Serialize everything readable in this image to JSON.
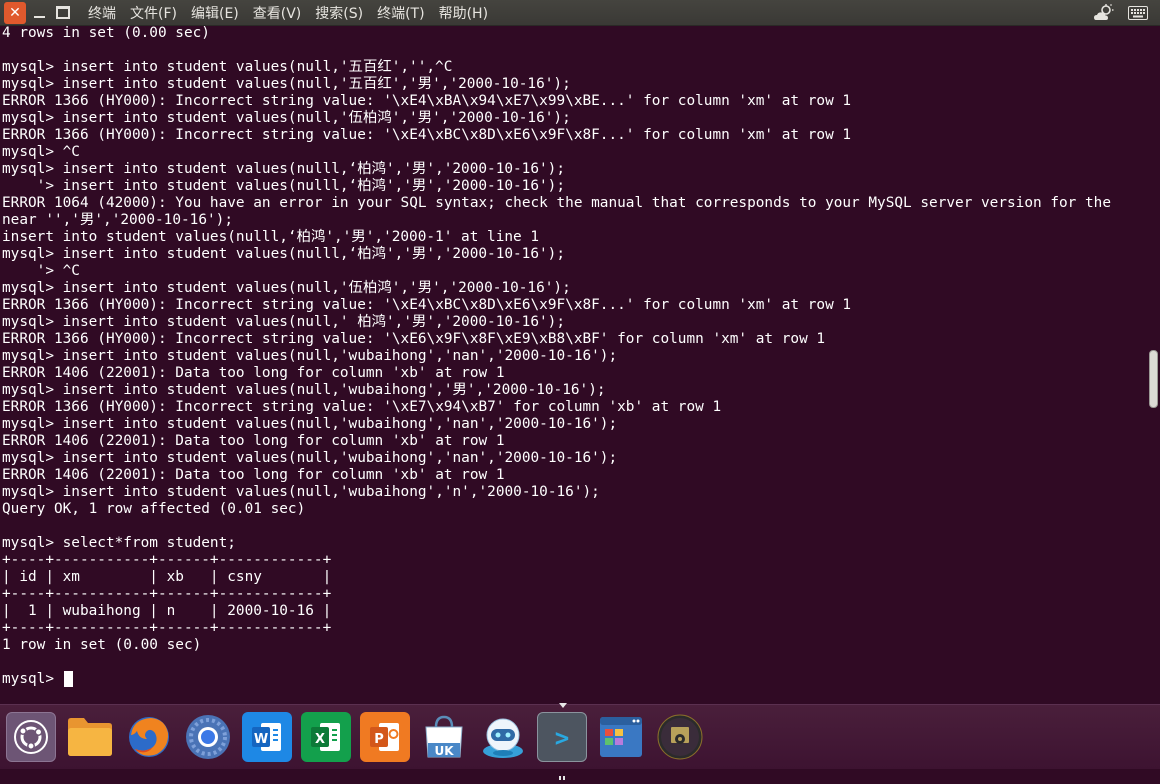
{
  "menubar": {
    "close_glyph": "✕",
    "items": [
      "终端",
      "文件(F)",
      "编辑(E)",
      "查看(V)",
      "搜索(S)",
      "终端(T)",
      "帮助(H)"
    ]
  },
  "terminal": {
    "lines": [
      "4 rows in set (0.00 sec)",
      "",
      "mysql> insert into student values(null,'五百红','',^C",
      "mysql> insert into student values(null,'五百红','男','2000-10-16');",
      "ERROR 1366 (HY000): Incorrect string value: '\\xE4\\xBA\\x94\\xE7\\x99\\xBE...' for column 'xm' at row 1",
      "mysql> insert into student values(null,'伍柏鸿','男','2000-10-16');",
      "ERROR 1366 (HY000): Incorrect string value: '\\xE4\\xBC\\x8D\\xE6\\x9F\\x8F...' for column 'xm' at row 1",
      "mysql> ^C",
      "mysql> insert into student values(nulll,‘柏鸿','男','2000-10-16');",
      "    '> insert into student values(nulll,‘柏鸿','男','2000-10-16');",
      "ERROR 1064 (42000): You have an error in your SQL syntax; check the manual that corresponds to your MySQL server version for the",
      "near '','男','2000-10-16');",
      "insert into student values(nulll,‘柏鸿','男','2000-1' at line 1",
      "mysql> insert into student values(nulll,‘柏鸿','男','2000-10-16');",
      "    '> ^C",
      "mysql> insert into student values(null,'伍柏鸿','男','2000-10-16');",
      "ERROR 1366 (HY000): Incorrect string value: '\\xE4\\xBC\\x8D\\xE6\\x9F\\x8F...' for column 'xm' at row 1",
      "mysql> insert into student values(null,' 柏鸿','男','2000-10-16');",
      "ERROR 1366 (HY000): Incorrect string value: '\\xE6\\x9F\\x8F\\xE9\\xB8\\xBF' for column 'xm' at row 1",
      "mysql> insert into student values(null,'wubaihong','nan','2000-10-16');",
      "ERROR 1406 (22001): Data too long for column 'xb' at row 1",
      "mysql> insert into student values(null,'wubaihong','男','2000-10-16');",
      "ERROR 1366 (HY000): Incorrect string value: '\\xE7\\x94\\xB7' for column 'xb' at row 1",
      "mysql> insert into student values(null,'wubaihong','nan','2000-10-16');",
      "ERROR 1406 (22001): Data too long for column 'xb' at row 1",
      "mysql> insert into student values(null,'wubaihong','nan','2000-10-16');",
      "ERROR 1406 (22001): Data too long for column 'xb' at row 1",
      "mysql> insert into student values(null,'wubaihong','n','2000-10-16');",
      "Query OK, 1 row affected (0.01 sec)",
      "",
      "mysql> select*from student;",
      "+----+-----------+------+------------+",
      "| id | xm        | xb   | csny       |",
      "+----+-----------+------+------------+",
      "|  1 | wubaihong | n    | 2000-10-16 |",
      "+----+-----------+------+------------+",
      "1 row in set (0.00 sec)",
      "",
      "mysql> "
    ]
  },
  "dock": {
    "items": [
      {
        "icon": "ubuntu-dash-icon"
      },
      {
        "icon": "files-folder-icon"
      },
      {
        "icon": "firefox-icon"
      },
      {
        "icon": "chromium-icon"
      },
      {
        "icon": "wps-writer-icon",
        "glyph": "W"
      },
      {
        "icon": "wps-spreadsheet-icon",
        "glyph": "X"
      },
      {
        "icon": "wps-presentation-icon",
        "glyph": "P"
      },
      {
        "icon": "ubuntu-kylin-software-icon",
        "glyph": "UK"
      },
      {
        "icon": "youker-assistant-icon"
      },
      {
        "icon": "terminal-icon",
        "glyph": ">"
      },
      {
        "icon": "workspace-switcher-icon"
      },
      {
        "icon": "dvd-drive-icon"
      }
    ]
  }
}
